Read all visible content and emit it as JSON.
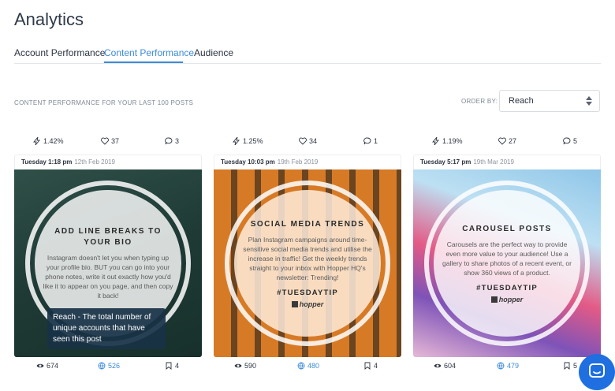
{
  "header": {
    "title": "Analytics"
  },
  "tabs": [
    {
      "label": "Account Performance"
    },
    {
      "label": "Content Performance"
    },
    {
      "label": "Audience"
    }
  ],
  "toolbar": {
    "subtitle": "CONTENT PERFORMANCE FOR YOUR LAST 100 POSTS",
    "order_label": "ORDER BY:",
    "order_value": "Reach"
  },
  "posts": [
    {
      "engagement": "1.42%",
      "likes": "37",
      "comments": "3",
      "day_time": "Tuesday 1:18 pm",
      "date": "12th Feb 2019",
      "title": "ADD LINE BREAKS TO YOUR BIO",
      "body": "Instagram doesn't let you when typing up your profile bio. BUT you can go into your phone notes, write it out exactly how you'd like it to appear on you page, and then copy it back!",
      "views": "674",
      "reach": "526",
      "saves": "4"
    },
    {
      "engagement": "1.25%",
      "likes": "34",
      "comments": "1",
      "day_time": "Tuesday 10:03 pm",
      "date": "19th Feb 2019",
      "title": "SOCIAL MEDIA TRENDS",
      "body": "Plan Instagram campaigns around time-sensitive social media trends and utilise the increase in traffic! Get the weekly trends straight to your inbox with Hopper HQ's newsletter: Trending!",
      "tag": "#TUESDAYTIP",
      "logo": "hopper",
      "views": "590",
      "reach": "480",
      "saves": "4"
    },
    {
      "engagement": "1.19%",
      "likes": "27",
      "comments": "5",
      "day_time": "Tuesday 5:17 pm",
      "date": "19th Mar 2019",
      "title": "CAROUSEL POSTS",
      "body": "Carousels are the perfect way to provide even more value to your audience! Use a gallery to share photos of a recent event, or show 360 views of a product.",
      "tag": "#TUESDAYTIP",
      "logo": "hopper",
      "views": "604",
      "reach": "479",
      "saves": "5"
    }
  ],
  "tooltip": {
    "text": "Reach - The total number of unique accounts that have seen this post"
  },
  "icons": {
    "engagement": "bolt-icon",
    "likes": "heart-icon",
    "comments": "comment-icon",
    "views": "eye-icon",
    "reach": "globe-icon",
    "saves": "bookmark-icon",
    "chat": "chat-icon"
  },
  "colors": {
    "accent": "#3d8bd9",
    "chat": "#1f6fe0"
  }
}
